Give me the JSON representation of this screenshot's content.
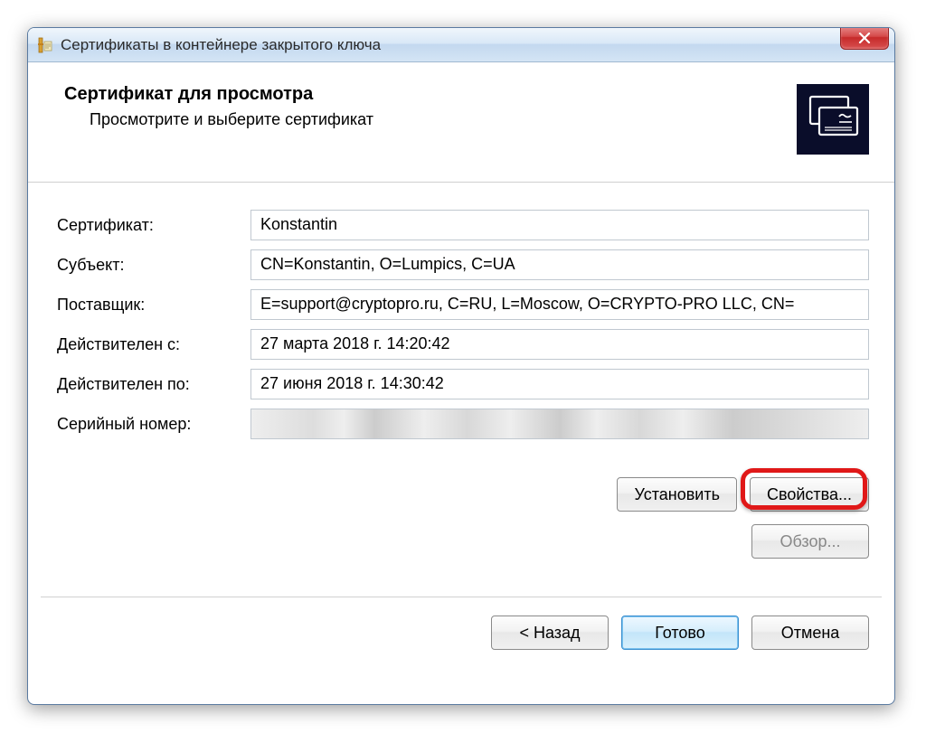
{
  "window": {
    "title": "Сертификаты в контейнере закрытого ключа"
  },
  "header": {
    "title": "Сертификат для просмотра",
    "subtitle": "Просмотрите и выберите сертификат"
  },
  "fields": {
    "certificate": {
      "label": "Сертификат:",
      "value": "Konstantin"
    },
    "subject": {
      "label": "Субъект:",
      "value": "CN=Konstantin, O=Lumpics, C=UA"
    },
    "issuer": {
      "label": "Поставщик:",
      "value": "E=support@cryptopro.ru, C=RU, L=Moscow, O=CRYPTO-PRO LLC, CN="
    },
    "valid_from": {
      "label": "Действителен с:",
      "value": "27 марта 2018 г. 14:20:42"
    },
    "valid_to": {
      "label": "Действителен по:",
      "value": "27 июня 2018 г. 14:30:42"
    },
    "serial": {
      "label": "Серийный номер:",
      "value": ""
    }
  },
  "buttons": {
    "install": "Установить",
    "properties": "Свойства...",
    "browse": "Обзор...",
    "back": "< Назад",
    "finish": "Готово",
    "cancel": "Отмена"
  }
}
